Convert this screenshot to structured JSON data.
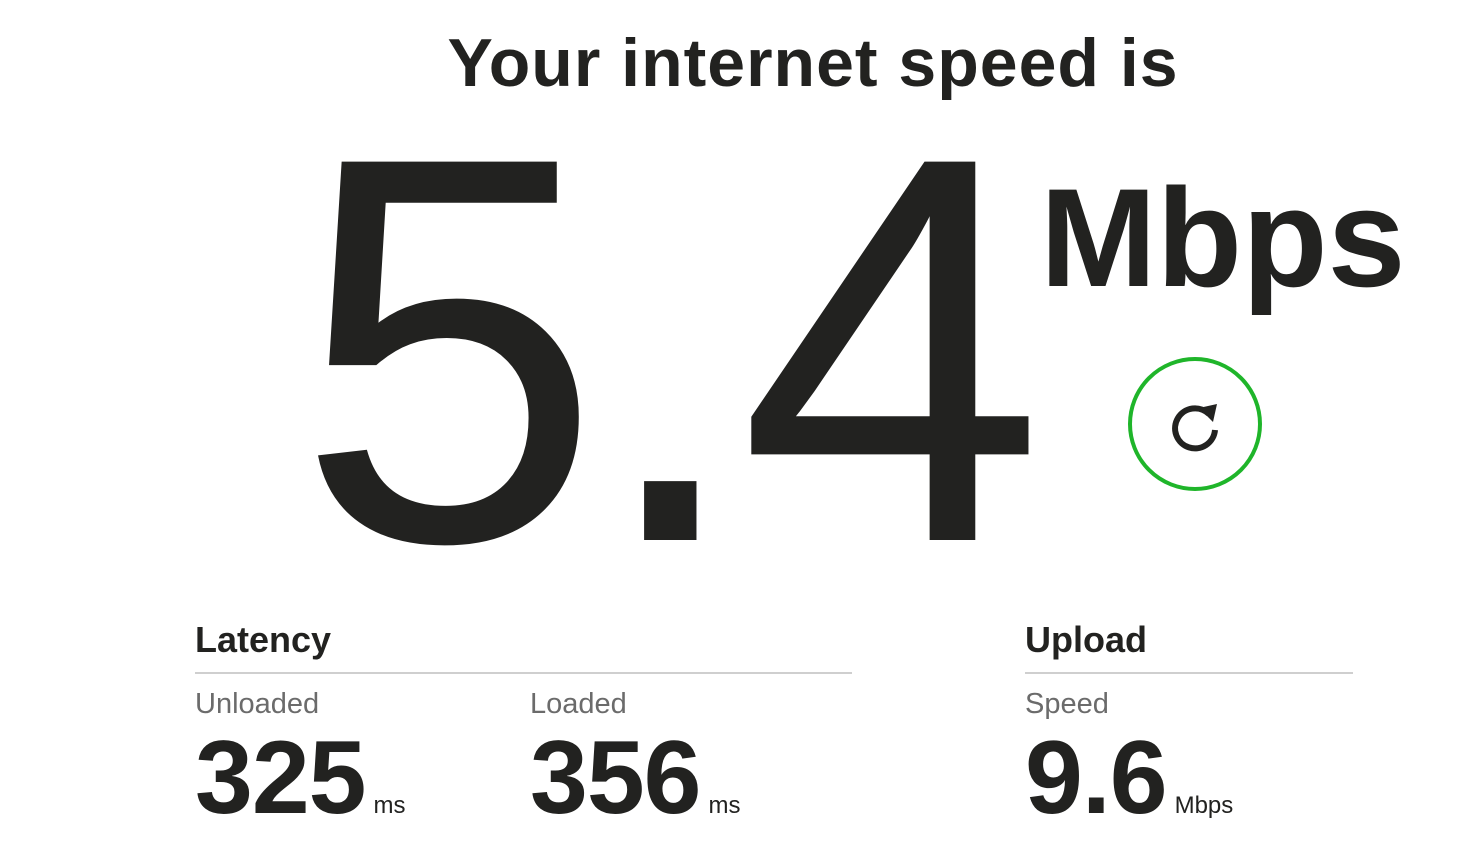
{
  "headline": "Your internet speed is",
  "speed": {
    "value": "5.4",
    "units": "Mbps"
  },
  "refresh": {
    "icon": "refresh-icon",
    "accent_color": "#1fb52a"
  },
  "latency": {
    "title": "Latency",
    "unloaded": {
      "label": "Unloaded",
      "value": "325",
      "unit": "ms"
    },
    "loaded": {
      "label": "Loaded",
      "value": "356",
      "unit": "ms"
    }
  },
  "upload": {
    "title": "Upload",
    "speed": {
      "label": "Speed",
      "value": "9.6",
      "unit": "Mbps"
    }
  }
}
